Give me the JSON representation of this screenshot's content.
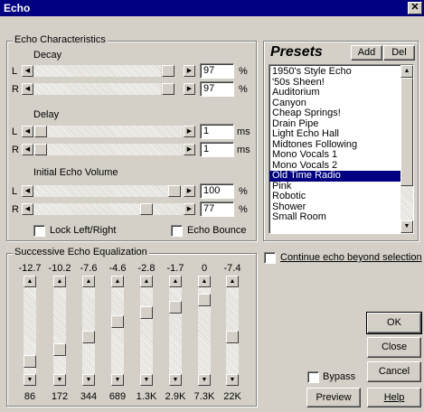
{
  "window": {
    "title": "Echo",
    "close_glyph": "✕"
  },
  "echo_characteristics": {
    "group_label": "Echo Characteristics",
    "decay": {
      "label": "Decay",
      "left_value": "97",
      "right_value": "97",
      "unit": "%"
    },
    "delay": {
      "label": "Delay",
      "left_value": "1",
      "right_value": "1",
      "unit": "ms"
    },
    "initial_volume": {
      "label": "Initial Echo Volume",
      "left_value": "100",
      "right_value": "77",
      "unit": "%"
    },
    "channel_left": "L",
    "channel_right": "R",
    "lock_label": "Lock Left/Right",
    "lock_checked": false,
    "bounce_label": "Echo Bounce",
    "bounce_checked": false
  },
  "presets": {
    "title": "Presets",
    "add_label": "Add",
    "del_label": "Del",
    "items": [
      "1950's Style Echo",
      "'50s Sheen!",
      "Auditorium",
      "Canyon",
      "Cheap Springs!",
      "Drain Pipe",
      "Light Echo Hall",
      "Midtones Following",
      "Mono Vocals 1",
      "Mono Vocals 2",
      "Old Time Radio",
      "Pink",
      "Robotic",
      "Shower",
      "Small Room"
    ],
    "selected_index": 10
  },
  "continue_echo": {
    "label": "Continue echo beyond selection",
    "checked": false
  },
  "equalization": {
    "group_label": "Successive Echo Equalization",
    "bands": [
      {
        "gain": "-12.7",
        "freq": "86",
        "level": 0.08
      },
      {
        "gain": "-10.2",
        "freq": "172",
        "level": 0.24
      },
      {
        "gain": "-7.6",
        "freq": "344",
        "level": 0.42
      },
      {
        "gain": "-4.6",
        "freq": "689",
        "level": 0.62
      },
      {
        "gain": "-2.8",
        "freq": "1.3K",
        "level": 0.74
      },
      {
        "gain": "-1.7",
        "freq": "2.9K",
        "level": 0.82
      },
      {
        "gain": "0",
        "freq": "7.3K",
        "level": 0.92
      },
      {
        "gain": "-7.4",
        "freq": "22K",
        "level": 0.42
      }
    ]
  },
  "buttons": {
    "ok": "OK",
    "close": "Close",
    "cancel": "Cancel",
    "bypass": "Bypass",
    "preview": "Preview",
    "help": "Help"
  },
  "colors": {
    "selection": "#000080",
    "titlebar": "#000080",
    "face": "#d4d0c8"
  }
}
